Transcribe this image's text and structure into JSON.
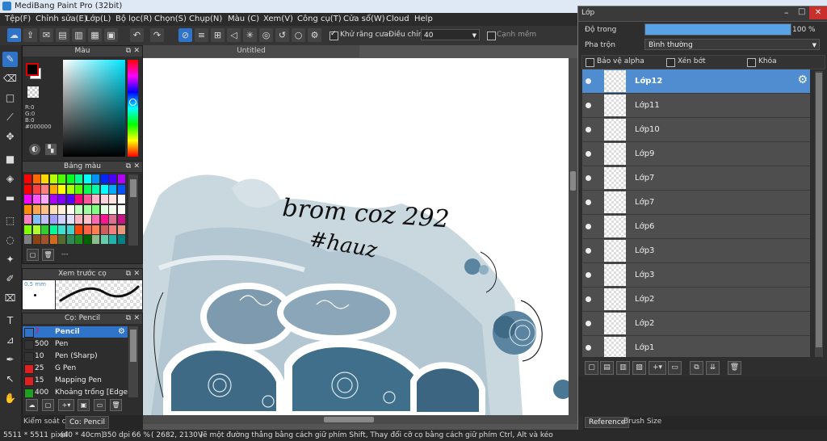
{
  "window": {
    "title": "MediBang Paint Pro (32bit)"
  },
  "menu": [
    "Tệp(F)",
    "Chỉnh sửa(E)",
    "Lớp(L)",
    "Bộ lọc(R)",
    "Chọn(S)",
    "Chụp(N)",
    "Màu (C)",
    "Xem(V)",
    "Công cụ(T)",
    "Cửa sổ(W)",
    "Cloud",
    "Help"
  ],
  "toolbar": {
    "antialias_label": "Khử răng cưa",
    "adjust_label": "Điều chỉnh",
    "adjust_value": "40",
    "snap_label": "Cạnh mềm"
  },
  "color_panel": {
    "title": "Màu",
    "r": "R:0",
    "g": "G:0",
    "b": "B:0",
    "hex": "#000000",
    "primary_color": "#000000"
  },
  "palette_panel": {
    "title": "Bảng màu",
    "extra": "---",
    "swatches": [
      "#ff0000",
      "#ff6a00",
      "#ffd800",
      "#b6ff00",
      "#4cff00",
      "#00ff21",
      "#00ff90",
      "#00ffff",
      "#0094ff",
      "#0026ff",
      "#4800ff",
      "#b200ff",
      "#ff0000",
      "#ff4040",
      "#ff8080",
      "#ffaa00",
      "#ffff00",
      "#aaff00",
      "#55ff00",
      "#00ff55",
      "#00ffaa",
      "#00ffff",
      "#00aaff",
      "#0055ff",
      "#ff00ff",
      "#ff55ff",
      "#ffaaff",
      "#aa00ff",
      "#7f00ff",
      "#5500ff",
      "#ff0080",
      "#ff5599",
      "#ffb3c6",
      "#ffd1dc",
      "#ffe4e1",
      "#ffffff",
      "#ff8c00",
      "#ffa54f",
      "#ffc087",
      "#ffe0b3",
      "#fff0d9",
      "#fffaf0",
      "#c0ffc0",
      "#a0ffa0",
      "#80ff80",
      "#e0ffe0",
      "#f0fff0",
      "#fafffa",
      "#ff80c0",
      "#80c0ff",
      "#c0c0ff",
      "#a0a0ff",
      "#d0d0ff",
      "#e0e0ff",
      "#ffb6c1",
      "#ffc0cb",
      "#ff69b4",
      "#ff1493",
      "#db7093",
      "#c71585",
      "#7fff00",
      "#adff2f",
      "#32cd32",
      "#00fa9a",
      "#40e0d0",
      "#48d1cc",
      "#ff4500",
      "#ff6347",
      "#ff7f50",
      "#cd5c5c",
      "#f08080",
      "#e9967a",
      "#808080",
      "#8b4513",
      "#a0522d",
      "#d2691e",
      "#556b2f",
      "#2e8b57",
      "#228b22",
      "#006400",
      "#8fbc8f",
      "#66cdaa",
      "#20b2aa",
      "#008080"
    ]
  },
  "preview_panel": {
    "title": "Xem trước cọ",
    "size": "0.5 mm"
  },
  "brush_panel": {
    "title": "Cọ: Pencil",
    "items": [
      {
        "size": "7",
        "name": "Pencil",
        "color": "#2f74c8",
        "selected": true
      },
      {
        "size": "500",
        "name": "Pen",
        "color": "#333333",
        "selected": false
      },
      {
        "size": "10",
        "name": "Pen (Sharp)",
        "color": "#333333",
        "selected": false
      },
      {
        "size": "25",
        "name": "G Pen",
        "color": "#e02020",
        "selected": false
      },
      {
        "size": "15",
        "name": "Mapping Pen",
        "color": "#e02020",
        "selected": false
      },
      {
        "size": "400",
        "name": "Khoảng trống [Edge]",
        "color": "#20a020",
        "selected": false
      }
    ]
  },
  "left_tabs": [
    "Kiểm soát co",
    "Co: Pencil"
  ],
  "document": {
    "tab_title": "Untitled",
    "handwriting_1": "brom coz 292",
    "handwriting_2": "#hauz"
  },
  "layers": {
    "title": "Lớp",
    "opacity_label": "Độ trong",
    "opacity_value": "100 %",
    "opacity": 1.0,
    "blend_label": "Pha trộn",
    "blend_value": "Bình thường",
    "protect_alpha": "Bảo vệ alpha",
    "clipping": "Xén bớt",
    "lock": "Khóa",
    "items": [
      {
        "name": "Lớp12",
        "selected": true
      },
      {
        "name": "Lớp11",
        "selected": false
      },
      {
        "name": "Lớp10",
        "selected": false
      },
      {
        "name": "Lớp9",
        "selected": false
      },
      {
        "name": "Lớp7",
        "selected": false
      },
      {
        "name": "Lớp7",
        "selected": false
      },
      {
        "name": "Lớp6",
        "selected": false
      },
      {
        "name": "Lớp3",
        "selected": false
      },
      {
        "name": "Lớp3",
        "selected": false
      },
      {
        "name": "Lớp2",
        "selected": false
      },
      {
        "name": "Lớp2",
        "selected": false
      },
      {
        "name": "Lớp1",
        "selected": false
      }
    ]
  },
  "bottom_tabs": [
    "Reference",
    "Brush Size"
  ],
  "status": {
    "size": "5511 * 5511 pixel",
    "physical": "(40 * 40cm)",
    "dpi": "350 dpi",
    "zoom": "66 %",
    "coords": "( 2682, 2130 )",
    "hint": "Vẽ một đường thẳng bằng cách giữ phím Shift, Thay đổi cỡ cọ bằng cách giữ phím Ctrl, Alt và kéo"
  }
}
